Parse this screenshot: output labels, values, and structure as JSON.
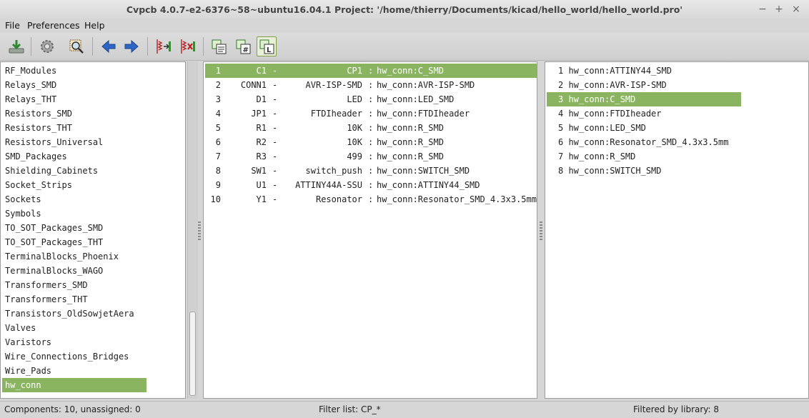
{
  "window": {
    "title": "Cvpcb 4.0.7-e2-6376~58~ubuntu16.04.1  Project: '/home/thierry/Documents/kicad/hello_world/hello_world.pro'",
    "controls": [
      "−",
      "+",
      "×"
    ]
  },
  "menu": [
    "File",
    "Preferences",
    "Help"
  ],
  "toolbar": {
    "buttons": [
      "save-icon",
      "settings-icon",
      "view-footprint-icon",
      "previous-icon",
      "next-icon",
      "auto-associate-icon",
      "delete-associations-icon",
      "filter-keywords-icon",
      "filter-pin-count-icon",
      "filter-library-icon"
    ],
    "active": "filter-library-icon",
    "accent": "#7ea04a"
  },
  "libraries": {
    "items": [
      "RF_Modules",
      "Relays_SMD",
      "Relays_THT",
      "Resistors_SMD",
      "Resistors_THT",
      "Resistors_Universal",
      "SMD_Packages",
      "Shielding_Cabinets",
      "Socket_Strips",
      "Sockets",
      "Symbols",
      "TO_SOT_Packages_SMD",
      "TO_SOT_Packages_THT",
      "TerminalBlocks_Phoenix",
      "TerminalBlocks_WAGO",
      "Transformers_SMD",
      "Transformers_THT",
      "Transistors_OldSowjetAera",
      "Valves",
      "Varistors",
      "Wire_Connections_Bridges",
      "Wire_Pads",
      "hw_conn"
    ],
    "selected": "hw_conn"
  },
  "components": {
    "rows": [
      {
        "num": "1",
        "ref": "C1",
        "sep": "-",
        "value": "CP1",
        "colon": ":",
        "footprint": "hw_conn:C_SMD"
      },
      {
        "num": "2",
        "ref": "CONN1",
        "sep": "-",
        "value": "AVR-ISP-SMD",
        "colon": ":",
        "footprint": "hw_conn:AVR-ISP-SMD"
      },
      {
        "num": "3",
        "ref": "D1",
        "sep": "-",
        "value": "LED",
        "colon": ":",
        "footprint": "hw_conn:LED_SMD"
      },
      {
        "num": "4",
        "ref": "JP1",
        "sep": "-",
        "value": "FTDIheader",
        "colon": ":",
        "footprint": "hw_conn:FTDIheader"
      },
      {
        "num": "5",
        "ref": "R1",
        "sep": "-",
        "value": "10K",
        "colon": ":",
        "footprint": "hw_conn:R_SMD"
      },
      {
        "num": "6",
        "ref": "R2",
        "sep": "-",
        "value": "10K",
        "colon": ":",
        "footprint": "hw_conn:R_SMD"
      },
      {
        "num": "7",
        "ref": "R3",
        "sep": "-",
        "value": "499",
        "colon": ":",
        "footprint": "hw_conn:R_SMD"
      },
      {
        "num": "8",
        "ref": "SW1",
        "sep": "-",
        "value": "switch_push",
        "colon": ":",
        "footprint": "hw_conn:SWITCH_SMD"
      },
      {
        "num": "9",
        "ref": "U1",
        "sep": "-",
        "value": "ATTINY44A-SSU",
        "colon": ":",
        "footprint": "hw_conn:ATTINY44_SMD"
      },
      {
        "num": "10",
        "ref": "Y1",
        "sep": "-",
        "value": "Resonator",
        "colon": ":",
        "footprint": "hw_conn:Resonator_SMD_4.3x3.5mm"
      }
    ],
    "selected_index": 0
  },
  "footprints": {
    "items": [
      "1 hw_conn:ATTINY44_SMD",
      "2 hw_conn:AVR-ISP-SMD",
      "3 hw_conn:C_SMD",
      "4 hw_conn:FTDIheader",
      "5 hw_conn:LED_SMD",
      "6 hw_conn:Resonator_SMD_4.3x3.5mm",
      "7 hw_conn:R_SMD",
      "8 hw_conn:SWITCH_SMD"
    ],
    "selected_index": 2
  },
  "status": {
    "components": "Components: 10, unassigned: 0",
    "filter": "Filter list: CP_*",
    "filtered": "Filtered by library: 8"
  },
  "colors": {
    "selection": "#8ab460"
  }
}
